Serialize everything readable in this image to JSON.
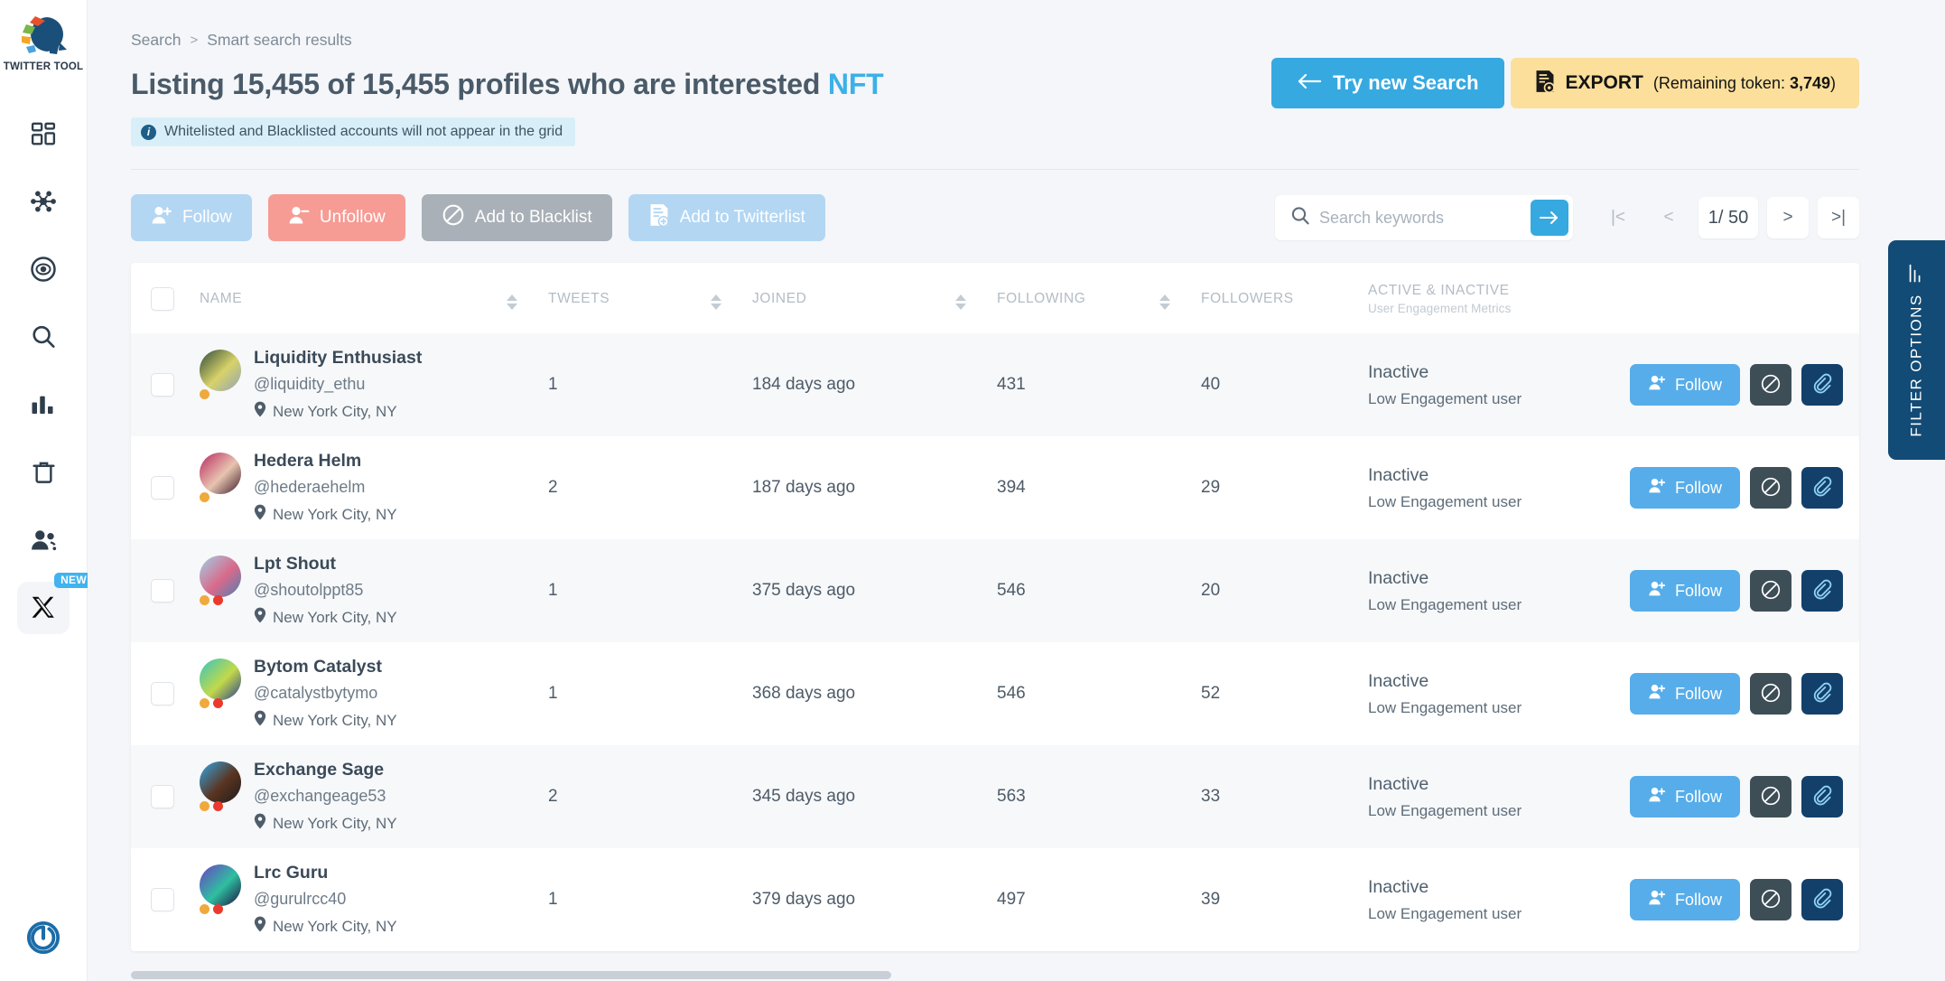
{
  "sidebar": {
    "brand_name": "TWITTER TOOL",
    "items": [
      {
        "icon": "dashboard-grid-icon",
        "label": "Dashboard"
      },
      {
        "icon": "network-nodes-icon",
        "label": "Network"
      },
      {
        "icon": "eye-target-icon",
        "label": "Monitor"
      },
      {
        "icon": "search-icon",
        "label": "Search"
      },
      {
        "icon": "bar-chart-icon",
        "label": "Analytics"
      },
      {
        "icon": "trash-icon",
        "label": "Trash"
      },
      {
        "icon": "users-group-icon",
        "label": "Audience"
      },
      {
        "icon": "x-twitter-icon",
        "label": "X",
        "badge": "NEW"
      }
    ],
    "bottom_icon": "power-logout-icon"
  },
  "breadcrumb": {
    "root": "Search",
    "separator": ">",
    "current": "Smart search results"
  },
  "header": {
    "title_prefix": "Listing 15,455 of 15,455 profiles who are interested",
    "title_accent": "NFT",
    "notice_icon": "info-icon",
    "notice": "Whitelisted and Blacklisted accounts will not appear in the grid",
    "try_new_search": "Try new Search",
    "try_new_search_icon": "arrow-left-icon",
    "export_label": "EXPORT",
    "export_icon": "export-file-icon",
    "export_token_prefix": "(Remaining token: ",
    "export_token_value": "3,749",
    "export_token_suffix": ")"
  },
  "toolbar": {
    "follow": "Follow",
    "unfollow": "Unfollow",
    "blacklist": "Add to Blacklist",
    "twitterlist": "Add to Twitterlist",
    "search_placeholder": "Search keywords",
    "search_value": "",
    "go_icon": "arrow-right-icon",
    "page_indicator": "1/ 50",
    "first_page": "|<",
    "prev_page": "<",
    "next_page": ">",
    "last_page": ">|"
  },
  "table": {
    "columns": [
      {
        "key": "name",
        "label": "NAME",
        "sortable": true
      },
      {
        "key": "tweets",
        "label": "TWEETS",
        "sortable": true
      },
      {
        "key": "joined",
        "label": "JOINED",
        "sortable": true
      },
      {
        "key": "following",
        "label": "FOLLOWING",
        "sortable": true
      },
      {
        "key": "followers",
        "label": "FOLLOWERS",
        "sortable": true
      },
      {
        "key": "engagement",
        "label": "ACTIVE & INACTIVE",
        "sublabel": "User Engagement Metrics",
        "sortable": false
      }
    ],
    "row_actions": {
      "follow": "Follow",
      "block_icon": "block-circle-icon",
      "link_icon": "paperclip-icon"
    },
    "rows": [
      {
        "name": "Liquidity Enthusiast",
        "handle": "@liquidity_ethu",
        "location": "New York City, NY",
        "tweets": "1",
        "joined": "184 days ago",
        "following": "431",
        "followers": "40",
        "status": "Inactive",
        "engagement": "Low Engagement user",
        "dots": [
          "orange"
        ],
        "avatar_colors": [
          "#2e4a3a",
          "#d8d26a",
          "#8fa3b8"
        ]
      },
      {
        "name": "Hedera Helm",
        "handle": "@hederaehelm",
        "location": "New York City, NY",
        "tweets": "2",
        "joined": "187 days ago",
        "following": "394",
        "followers": "29",
        "status": "Inactive",
        "engagement": "Low Engagement user",
        "dots": [
          "orange"
        ],
        "avatar_colors": [
          "#b8275f",
          "#e8c4b0",
          "#3a1a28"
        ]
      },
      {
        "name": "Lpt Shout",
        "handle": "@shoutolppt85",
        "location": "New York City, NY",
        "tweets": "1",
        "joined": "375 days ago",
        "following": "546",
        "followers": "20",
        "status": "Inactive",
        "engagement": "Low Engagement user",
        "dots": [
          "orange",
          "red"
        ],
        "avatar_colors": [
          "#9fd0e8",
          "#d96a8a",
          "#4a7fb5"
        ]
      },
      {
        "name": "Bytom Catalyst",
        "handle": "@catalystbytymo",
        "location": "New York City, NY",
        "tweets": "1",
        "joined": "368 days ago",
        "following": "546",
        "followers": "52",
        "status": "Inactive",
        "engagement": "Low Engagement user",
        "dots": [
          "orange",
          "red"
        ],
        "avatar_colors": [
          "#35c4c0",
          "#c2d94a",
          "#2a3f8f"
        ]
      },
      {
        "name": "Exchange Sage",
        "handle": "@exchangeage53",
        "location": "New York City, NY",
        "tweets": "2",
        "joined": "345 days ago",
        "following": "563",
        "followers": "33",
        "status": "Inactive",
        "engagement": "Low Engagement user",
        "dots": [
          "orange",
          "red"
        ],
        "avatar_colors": [
          "#33a8e8",
          "#5a3420",
          "#1c1c1c"
        ]
      },
      {
        "name": "Lrc Guru",
        "handle": "@gurulrcc40",
        "location": "New York City, NY",
        "tweets": "1",
        "joined": "379 days ago",
        "following": "497",
        "followers": "39",
        "status": "Inactive",
        "engagement": "Low Engagement user",
        "dots": [
          "orange",
          "red"
        ],
        "avatar_colors": [
          "#6a3fc4",
          "#2fbfa0",
          "#1a1040"
        ]
      }
    ]
  },
  "filter_panel": {
    "label": "FILTER OPTIONS",
    "icon": "filter-lines-icon"
  },
  "colors": {
    "accent_blue": "#36a9e1",
    "export_yellow": "#fbdf9b",
    "dark_navy": "#124b75",
    "title_gray": "#4a5a68"
  }
}
